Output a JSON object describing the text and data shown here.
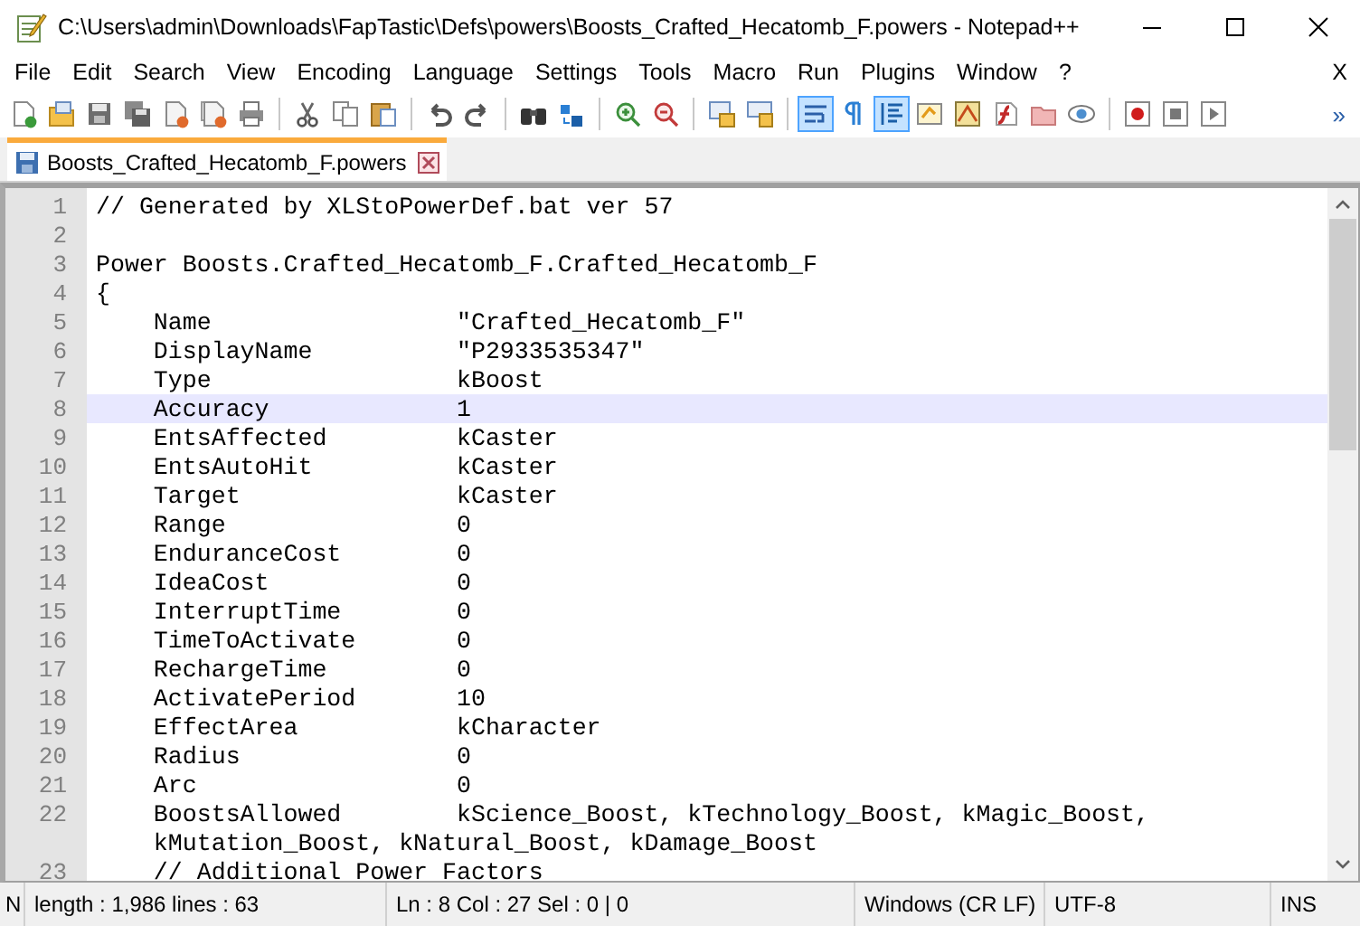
{
  "window": {
    "title": "C:\\Users\\admin\\Downloads\\FapTastic\\Defs\\powers\\Boosts_Crafted_Hecatomb_F.powers - Notepad++"
  },
  "menu": [
    "File",
    "Edit",
    "Search",
    "View",
    "Encoding",
    "Language",
    "Settings",
    "Tools",
    "Macro",
    "Run",
    "Plugins",
    "Window",
    "?"
  ],
  "menu_close": "X",
  "toolbar": [
    {
      "kind": "new",
      "selected": false
    },
    {
      "kind": "open",
      "selected": false
    },
    {
      "kind": "save",
      "selected": false
    },
    {
      "kind": "save-all",
      "selected": false
    },
    {
      "kind": "close",
      "selected": false
    },
    {
      "kind": "close-all",
      "selected": false
    },
    {
      "kind": "print",
      "selected": false
    },
    {
      "kind": "separator"
    },
    {
      "kind": "cut",
      "selected": false
    },
    {
      "kind": "copy",
      "selected": false
    },
    {
      "kind": "paste",
      "selected": false
    },
    {
      "kind": "separator"
    },
    {
      "kind": "undo",
      "selected": false
    },
    {
      "kind": "redo",
      "selected": false
    },
    {
      "kind": "separator"
    },
    {
      "kind": "find",
      "selected": false
    },
    {
      "kind": "replace",
      "selected": false
    },
    {
      "kind": "separator"
    },
    {
      "kind": "zoom-in",
      "selected": false
    },
    {
      "kind": "zoom-out",
      "selected": false
    },
    {
      "kind": "separator"
    },
    {
      "kind": "sync-vertical",
      "selected": false
    },
    {
      "kind": "sync-horizontal",
      "selected": false
    },
    {
      "kind": "separator"
    },
    {
      "kind": "word-wrap",
      "selected": true
    },
    {
      "kind": "all-chars",
      "selected": false
    },
    {
      "kind": "indent-guide",
      "selected": true
    },
    {
      "kind": "language",
      "selected": false
    },
    {
      "kind": "doc-map",
      "selected": false
    },
    {
      "kind": "function-list",
      "selected": false
    },
    {
      "kind": "folder",
      "selected": false
    },
    {
      "kind": "monitor",
      "selected": false
    },
    {
      "kind": "separator"
    },
    {
      "kind": "record",
      "selected": false
    },
    {
      "kind": "stop",
      "selected": false
    },
    {
      "kind": "play",
      "selected": false
    }
  ],
  "toolbar_overflow": "»",
  "tabs": [
    {
      "label": "Boosts_Crafted_Hecatomb_F.powers",
      "selected": true
    }
  ],
  "lines": [
    {
      "number": "1",
      "text": "// Generated by XLStoPowerDef.bat ver 57",
      "current": false
    },
    {
      "number": "2",
      "current": false
    },
    {
      "number": "3",
      "text": "Power Boosts.Crafted_Hecatomb_F.Crafted_Hecatomb_F",
      "current": false
    },
    {
      "number": "4",
      "text": "{",
      "current": false
    },
    {
      "number": "5",
      "text": "    Name                 \"Crafted_Hecatomb_F\"",
      "current": false
    },
    {
      "number": "6",
      "text": "    DisplayName          \"P2933535347\"",
      "current": false
    },
    {
      "number": "7",
      "text": "    Type                 kBoost",
      "current": false
    },
    {
      "number": "8",
      "text": "    Accuracy             1",
      "current": true
    },
    {
      "number": "9",
      "text": "    EntsAffected         kCaster",
      "current": false
    },
    {
      "number": "10",
      "text": "    EntsAutoHit          kCaster",
      "current": false
    },
    {
      "number": "11",
      "text": "    Target               kCaster",
      "current": false
    },
    {
      "number": "12",
      "text": "    Range                0",
      "current": false
    },
    {
      "number": "13",
      "text": "    EnduranceCost        0",
      "current": false
    },
    {
      "number": "14",
      "text": "    IdeaCost             0",
      "current": false
    },
    {
      "number": "15",
      "text": "    InterruptTime        0",
      "current": false
    },
    {
      "number": "16",
      "text": "    TimeToActivate       0",
      "current": false
    },
    {
      "number": "17",
      "text": "    RechargeTime         0",
      "current": false
    },
    {
      "number": "18",
      "text": "    ActivatePeriod       10",
      "current": false
    },
    {
      "number": "19",
      "text": "    EffectArea           kCharacter",
      "current": false
    },
    {
      "number": "20",
      "text": "    Radius               0",
      "current": false
    },
    {
      "number": "21",
      "text": "    Arc                  0",
      "current": false
    },
    {
      "number": "22",
      "text": "    BoostsAllowed        kScience_Boost, kTechnology_Boost, kMagic_Boost,",
      "continuation": "    kMutation_Boost, kNatural_Boost, kDamage_Boost",
      "current": false
    },
    {
      "number": "23",
      "text": "    // Additional Power Factors",
      "current": false
    }
  ],
  "status_bar": [
    "N",
    "length : 1,986    lines : 63",
    "Ln : 8    Col : 27    Sel : 0 | 0",
    "Windows (CR LF)",
    "UTF-8",
    "INS"
  ]
}
